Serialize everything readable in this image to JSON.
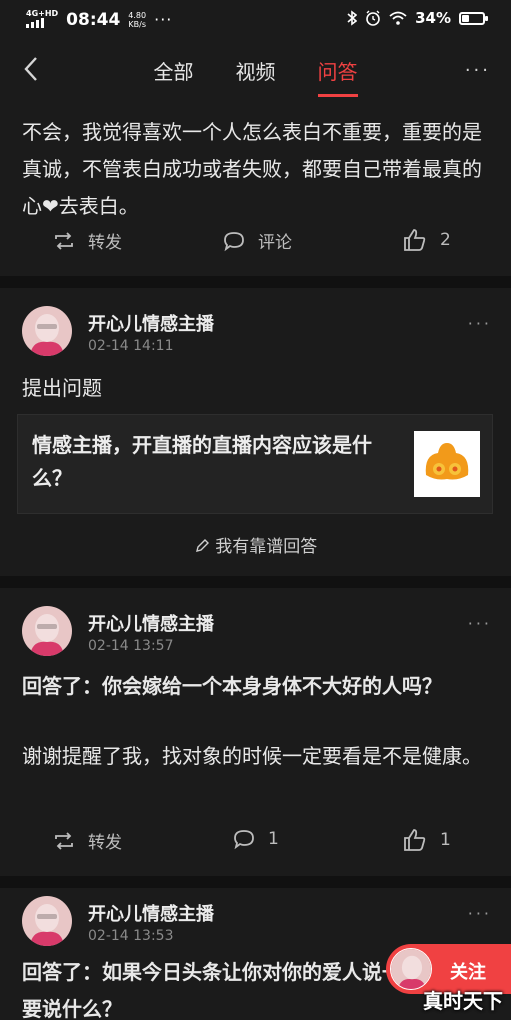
{
  "status_bar": {
    "signal": "4G+HD",
    "time": "08:44",
    "speed_value": "4.80",
    "speed_unit": "KB/s",
    "dots": "···",
    "battery": "34%",
    "battery_level": 0.34
  },
  "nav": {
    "tabs": [
      "全部",
      "视频",
      "问答"
    ],
    "active_tab": "问答",
    "more": "···"
  },
  "post1": {
    "text": "不会，我觉得喜欢一个人怎么表白不重要，重要的是真诚，不管表白成功或者失败，都要自己带着最真的心❤去表白。",
    "repost": "转发",
    "comment": "评论",
    "likes": "2"
  },
  "post2": {
    "author": "开心儿情感主播",
    "time": "02-14 14:11",
    "more": "···",
    "action_text": "提出问题",
    "question": "情感主播，开直播的直播内容应该是什么？",
    "answer_link": "我有靠谱回答"
  },
  "post3": {
    "author": "开心儿情感主播",
    "time": "02-14 13:57",
    "more": "···",
    "title": "回答了：你会嫁给一个本身身体不大好的人吗？",
    "text": "谢谢提醒了我，找对象的时候一定要看是不是健康。",
    "repost": "转发",
    "comments": "1",
    "likes": "1"
  },
  "post4": {
    "author": "开心儿情感主播",
    "time": "02-14 13:53",
    "more": "···",
    "title": "回答了：如果今日头条让你对你的爱人说一句话，你要说什么？"
  },
  "follow": {
    "label": "关注"
  },
  "watermark": "真时天下",
  "colors": {
    "accent": "#f04142",
    "background": "#1b1b1b",
    "text": "#e8e8e8",
    "muted": "#8a8a8a"
  }
}
